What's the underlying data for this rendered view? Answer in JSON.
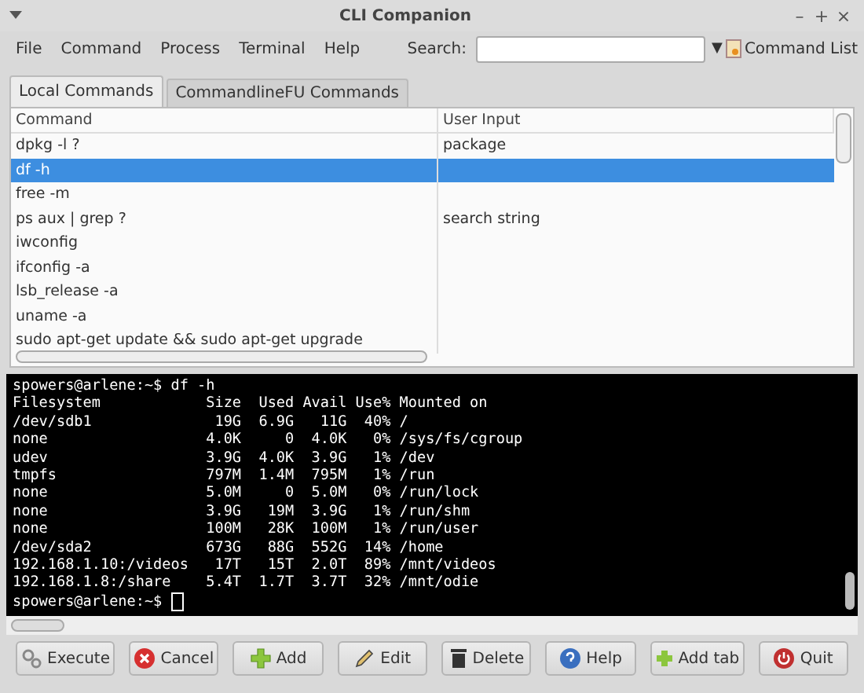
{
  "window": {
    "title": "CLI Companion",
    "controls": [
      "–",
      "+",
      "×"
    ]
  },
  "menu": [
    "File",
    "Command",
    "Process",
    "Terminal",
    "Help"
  ],
  "search": {
    "label": "Search:",
    "dropdown": "▼",
    "button": "Command List"
  },
  "tabs": [
    {
      "label": "Local Commands",
      "selected": true
    },
    {
      "label": "CommandlineFU Commands",
      "selected": false
    }
  ],
  "table": {
    "columns": [
      "Command",
      "User Input"
    ],
    "rows": [
      {
        "command": "dpkg -l ?",
        "input": "package",
        "selected": false
      },
      {
        "command": "df -h",
        "selected": true
      },
      {
        "command": "free -m",
        "selected": false
      },
      {
        "command": "ps aux | grep ?",
        "input": "search string",
        "selected": false
      },
      {
        "command": "iwconfig",
        "selected": false
      },
      {
        "command": "ifconfig -a",
        "selected": false
      },
      {
        "command": "lsb_release -a",
        "selected": false
      },
      {
        "command": "uname -a",
        "selected": false
      },
      {
        "command": "sudo apt-get update && sudo apt-get upgrade",
        "selected": false
      }
    ]
  },
  "terminal": {
    "lines": [
      "spowers@arlene:~$ df -h",
      "Filesystem            Size  Used Avail Use% Mounted on",
      "/dev/sdb1              19G  6.9G   11G  40% /",
      "none                  4.0K     0  4.0K   0% /sys/fs/cgroup",
      "udev                  3.9G  4.0K  3.9G   1% /dev",
      "tmpfs                 797M  1.4M  795M   1% /run",
      "none                  5.0M     0  5.0M   0% /run/lock",
      "none                  3.9G   19M  3.9G   1% /run/shm",
      "none                  100M   28K  100M   1% /run/user",
      "/dev/sda2             673G   88G  552G  14% /home",
      "192.168.1.10:/videos   17T   15T  2.0T  89% /mnt/videos",
      "192.168.1.8:/share    5.4T  1.7T  3.7T  32% /mnt/odie"
    ],
    "prompt": "spowers@arlene:~$ "
  },
  "buttons": [
    {
      "label": "Execute",
      "kind": "execute"
    },
    {
      "label": "Cancel",
      "kind": "cancel"
    },
    {
      "label": "Add",
      "kind": "add"
    },
    {
      "label": "Edit",
      "kind": "edit"
    },
    {
      "label": "Delete",
      "kind": "delete"
    },
    {
      "label": "Help",
      "kind": "help"
    },
    {
      "label": "Add tab",
      "kind": "addtab"
    },
    {
      "label": "Quit",
      "kind": "quit"
    }
  ]
}
